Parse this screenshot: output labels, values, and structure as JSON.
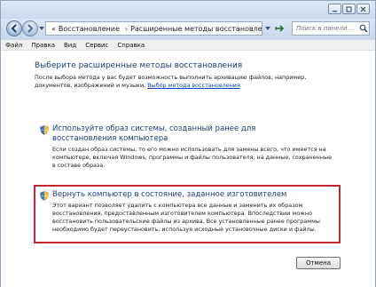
{
  "address": {
    "breadcrumb_overflow": "«",
    "crumb1": "Восстановление",
    "separator": "›",
    "crumb2": "Расширенные методы восстановления",
    "search_placeholder": "Поиск в панели ..."
  },
  "menu": {
    "file": "Файл",
    "edit": "Правка",
    "view": "Вид",
    "service": "Сервис",
    "help": "Справка"
  },
  "page": {
    "title": "Выберите расширенные методы восстановления",
    "intro_text": "После выбора метода у вас будет возможность выполнить архивацию файлов, например, документов, изображений и музыки.",
    "intro_link": "Выбор метода восстановления"
  },
  "options": {
    "image": {
      "title": "Используйте образ системы, созданный ранее для восстановления компьютера",
      "description": "Если создан образ системы, то его можно использовать для замены всего, что имеется на компьютере, включая Windows, программы и файлы пользователя, на данные, сохраненные в составе образа."
    },
    "factory": {
      "title": "Вернуть компьютер в состояние, заданное изготовителем",
      "description": "Этот вариант позволяет удалить с компьютера все данные и заменить их образом восстановления, предоставленным изготовителем компьютера. Впоследствии можно восстановить пользовательские файлы из архива. Все установленные ранее программы необходимо будет переустановить, используя исходные установочные диски и файлы."
    }
  },
  "buttons": {
    "cancel": "Отмена"
  },
  "colors": {
    "highlight": "#c0282d",
    "heading": "#1f3f7a",
    "link": "#0645ad"
  }
}
